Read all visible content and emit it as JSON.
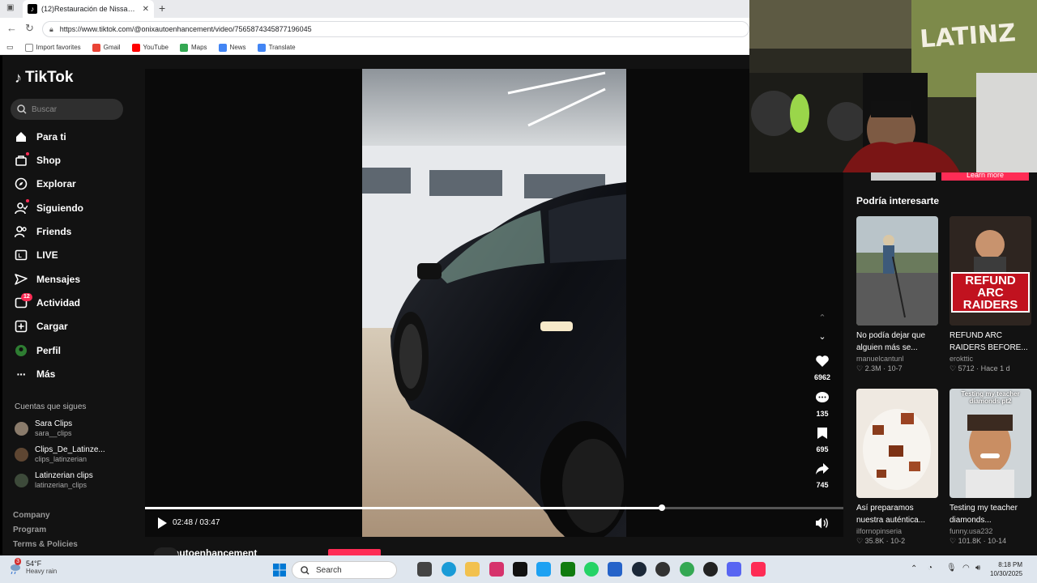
{
  "browser": {
    "tab_title": "(12)Restauración de Nissan Skylin",
    "new_tab_icon": "plus-icon",
    "url": "https://www.tiktok.com/@onixautoenhancement/video/7565874345877196045",
    "bookmarks": [
      {
        "label": "Import favorites",
        "color": "#888888"
      },
      {
        "label": "Gmail",
        "color": "#ea4335"
      },
      {
        "label": "YouTube",
        "color": "#ff0000"
      },
      {
        "label": "Maps",
        "color": "#34a853"
      },
      {
        "label": "News",
        "color": "#4285f4"
      },
      {
        "label": "Translate",
        "color": "#4285f4"
      }
    ]
  },
  "tiktok": {
    "logo": "TikTok",
    "search_placeholder": "Buscar",
    "nav": [
      {
        "label": "Para ti",
        "icon": "home-icon"
      },
      {
        "label": "Shop",
        "icon": "shop-icon"
      },
      {
        "label": "Explorar",
        "icon": "compass-icon"
      },
      {
        "label": "Siguiendo",
        "icon": "following-icon"
      },
      {
        "label": "Friends",
        "icon": "friends-icon"
      },
      {
        "label": "LIVE",
        "icon": "live-icon"
      },
      {
        "label": "Mensajes",
        "icon": "message-icon"
      },
      {
        "label": "Actividad",
        "icon": "activity-icon",
        "badge": "12"
      },
      {
        "label": "Cargar",
        "icon": "upload-icon"
      },
      {
        "label": "Perfil",
        "icon": "profile-icon"
      },
      {
        "label": "Más",
        "icon": "more-icon"
      }
    ],
    "following_title": "Cuentas que sigues",
    "following": [
      {
        "name": "Sara Clips",
        "user": "sara__clips"
      },
      {
        "name": "Clips_De_Latinze...",
        "user": "clips_latinzerian"
      },
      {
        "name": "Latinzerian clips",
        "user": "latinzerian_clips"
      }
    ],
    "footer": [
      "Company",
      "Program",
      "Terms & Policies"
    ],
    "player": {
      "time": "02:48 / 03:47",
      "progress": 0.74,
      "likes": "6962",
      "comments": "135",
      "saves": "695",
      "shares": "745"
    },
    "author": "onixautoenhancement",
    "learn_more": "Learn more",
    "rec_title": "Podría interesarte",
    "recommendations": [
      {
        "title": "No podía dejar que alguien más se...",
        "user": "manuelcantunl",
        "likes": "2.3M",
        "date": "10-7"
      },
      {
        "title": "REFUND ARC RAIDERS BEFORE...",
        "user": "erokttic",
        "likes": "5712",
        "date": "Hace 1 d",
        "overlay": "REFUND ARC RAIDERS"
      },
      {
        "title": "Así preparamos nuestra auténtica...",
        "user": "ilfornopinseria",
        "likes": "35.8K",
        "date": "10-2"
      },
      {
        "title": "Testing my teacher diamonds...",
        "user": "funny.usa232",
        "likes": "101.8K",
        "date": "10-14",
        "overlay": "Testing my teacher diamonds pt2"
      }
    ]
  },
  "taskbar": {
    "weather_badge": "3",
    "temp": "54°F",
    "weather": "Heavy rain",
    "search": "Search",
    "time": "8:18 PM",
    "date": "10/30/2025"
  }
}
